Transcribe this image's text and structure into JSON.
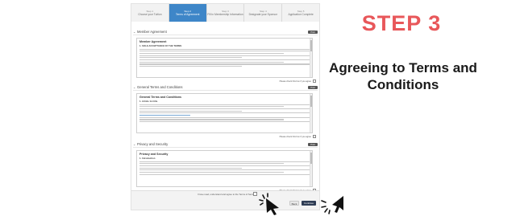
{
  "stepper": {
    "steps": [
      {
        "num": "Step 1",
        "label": "Choose your Tuition"
      },
      {
        "num": "Step 2",
        "label": "Terms of Agreement"
      },
      {
        "num": "Step 3",
        "label": "Fill in Membership Information"
      },
      {
        "num": "Step 4",
        "label": "Designate your Sponsor"
      },
      {
        "num": "Step 5",
        "label": "Application Complete"
      }
    ]
  },
  "sections": [
    {
      "heading": "Member Agreement",
      "print": "Print",
      "box_title": "Member Agreement",
      "box_sub": "1. SOLE ACCEPTANCE OF THE TERMS",
      "agree": "Please check this box if you agree"
    },
    {
      "heading": "General Terms and Conditions",
      "print": "Print",
      "box_title": "General Terms and Conditions",
      "box_sub": "1. Article 1st title",
      "agree": "Please check this box if you agree"
    },
    {
      "heading": "Privacy and Security",
      "print": "Print",
      "box_title": "Privacy and Security",
      "box_sub": "1. Introduction",
      "agree": "Please check this box if you agree"
    }
  ],
  "footer": {
    "agree_all": "I have read, understand and agree to the Terms of Service",
    "back": "Back",
    "continue": "Continue"
  },
  "caption": {
    "step": "STEP 3",
    "step_color": "#e8575a",
    "text": "Agreeing to Terms and Conditions"
  },
  "icons": {
    "cursor": "pointer-hand-click-icon"
  }
}
